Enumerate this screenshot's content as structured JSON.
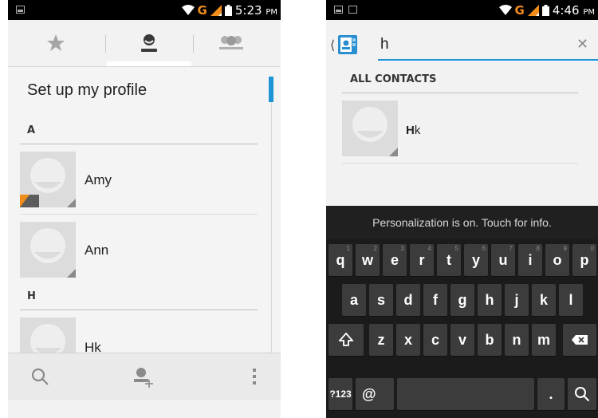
{
  "left": {
    "status": {
      "network": "G",
      "time": "5:23",
      "ampm": "PM"
    },
    "tabs": [
      {
        "icon": "star-icon"
      },
      {
        "icon": "person-icon",
        "selected": true
      },
      {
        "icon": "group-icon"
      }
    ],
    "profile_label": "Set up my profile",
    "sections": [
      {
        "header": "A",
        "contacts": [
          {
            "name": "Amy"
          },
          {
            "name": "Ann"
          }
        ]
      },
      {
        "header": "H",
        "contacts": [
          {
            "name": "Hk"
          }
        ]
      }
    ],
    "bottom": [
      {
        "icon": "search-icon"
      },
      {
        "icon": "add-contact-icon"
      },
      {
        "icon": "overflow-menu-icon"
      }
    ]
  },
  "right": {
    "status": {
      "network": "G",
      "time": "4:46",
      "ampm": "PM"
    },
    "search": {
      "value": "h"
    },
    "results_header": "ALL CONTACTS",
    "result": {
      "match": "H",
      "rest": "k"
    },
    "keyboard": {
      "tip": "Personalization is on. Touch for info.",
      "row1": [
        "q",
        "w",
        "e",
        "r",
        "t",
        "y",
        "u",
        "i",
        "o",
        "p"
      ],
      "row1_hints": [
        "1",
        "2",
        "3",
        "4",
        "5",
        "6",
        "7",
        "8",
        "9",
        "0"
      ],
      "row2": [
        "a",
        "s",
        "d",
        "f",
        "g",
        "h",
        "j",
        "k",
        "l"
      ],
      "row3": [
        "z",
        "x",
        "c",
        "v",
        "b",
        "n",
        "m"
      ],
      "sym_label": "?123",
      "at_label": "@",
      "period_label": "."
    }
  },
  "colors": {
    "accent": "#1d94d6",
    "network": "#f08c1a"
  }
}
